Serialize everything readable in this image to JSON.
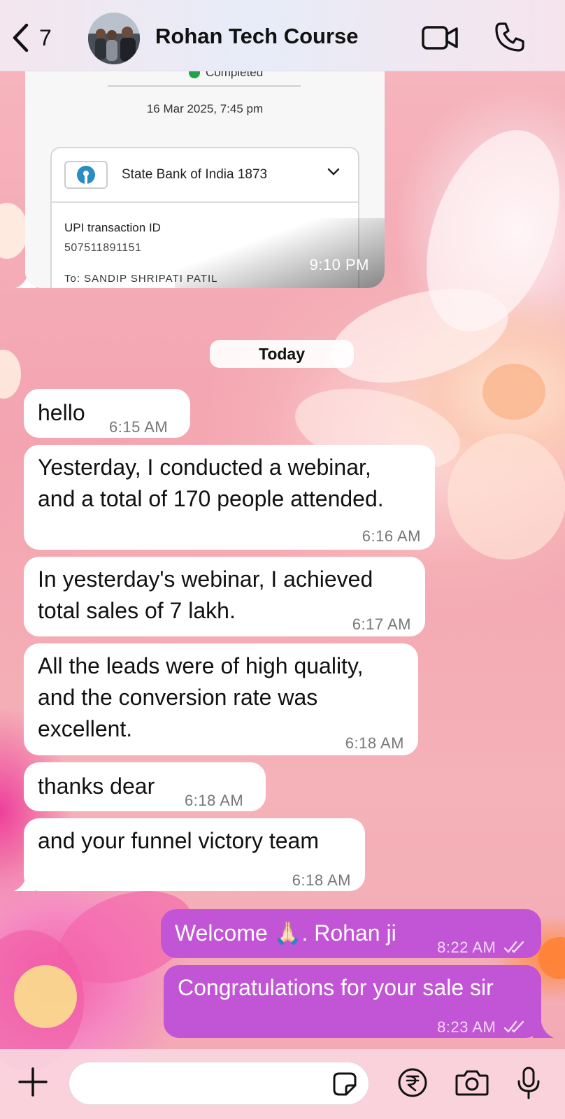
{
  "header": {
    "back_count": "7",
    "title": "Rohan Tech Course"
  },
  "image_message": {
    "status": "Completed",
    "date": "16 Mar 2025, 7:45 pm",
    "bank_name": "State Bank of India 1873",
    "upi_label": "UPI transaction ID",
    "upi_id": "507511891151",
    "to_line": "To: SANDIP SHRIPATI PATIL",
    "time": "9:10 PM"
  },
  "date_separator": "Today",
  "messages": [
    {
      "direction": "in",
      "lines": [
        "hello"
      ],
      "time": "6:15 AM"
    },
    {
      "direction": "in",
      "lines": [
        "Yesterday, I conducted a webinar,",
        "and a total of 170 people attended."
      ],
      "time": "6:16 AM"
    },
    {
      "direction": "in",
      "lines": [
        "In yesterday's webinar, I achieved",
        "total sales of 7 lakh."
      ],
      "time": "6:17 AM"
    },
    {
      "direction": "in",
      "lines": [
        "All the leads were of high quality,",
        "and the conversion rate was",
        "excellent."
      ],
      "time": "6:18 AM"
    },
    {
      "direction": "in",
      "lines": [
        "thanks dear"
      ],
      "time": "6:18 AM"
    },
    {
      "direction": "in",
      "lines": [
        "and your funnel victory team"
      ],
      "time": "6:18 AM"
    },
    {
      "direction": "out",
      "lines": [
        "Welcome 🙏🏻. Rohan ji"
      ],
      "time": "8:22 AM",
      "status": "read"
    },
    {
      "direction": "out",
      "lines": [
        "Congratulations for your sale sir"
      ],
      "time": "8:23 AM",
      "status": "read"
    }
  ],
  "composer": {
    "placeholder": ""
  },
  "icons": {
    "back": "chevron-left-icon",
    "video": "video-camera-icon",
    "call": "phone-icon",
    "plus": "plus-icon",
    "sticker": "sticker-icon",
    "payment": "rupee-icon",
    "camera": "camera-icon",
    "mic": "microphone-icon"
  },
  "colors": {
    "outgoing_bubble": "#c254d6",
    "incoming_bubble": "#ffffff",
    "wallpaper": "#f4a9b4"
  }
}
